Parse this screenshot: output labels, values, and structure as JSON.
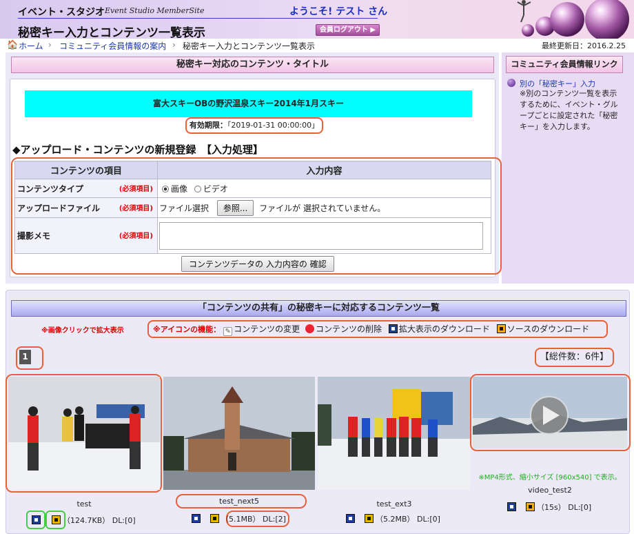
{
  "header": {
    "site_name": "イベント・スタジオ",
    "site_name_en": "Event Studio MemberSite",
    "welcome": "ようこそ! テスト さん",
    "page_title": "秘密キー入力とコンテンツ一覧表示",
    "logout_label": "会員ログアウト"
  },
  "breadcrumb": {
    "home": "ホーム",
    "community": "コミュニティ会員情報の案内",
    "current": "秘密キー入力とコンテンツ一覧表示",
    "last_updated": "最終更新日：2016.2.25"
  },
  "main": {
    "section_title": "秘密キー対応のコンテンツ・タイトル",
    "event_title": "富大スキーOBの野沢温泉スキー2014年1月スキー",
    "expiry_label": "有効期限：",
    "expiry_value": "「2019-01-31 00:00:00」",
    "upload_heading": "◆アップロード・コンテンツの新規登録　【入力処理】",
    "form": {
      "col_item": "コンテンツの項目",
      "col_input": "入力内容",
      "required": "(必須項目)",
      "type_label": "コンテンツタイプ",
      "type_options": [
        "画像",
        "ビデオ"
      ],
      "type_selected": "画像",
      "file_label": "アップロードファイル",
      "file_choose": "ファイル選択",
      "browse_button": "参照...",
      "file_status": "ファイルが 選択されていません。",
      "memo_label": "撮影メモ",
      "confirm_button": "コンテンツデータの 入力内容の 確認"
    }
  },
  "sidebar": {
    "title": "コミュニティ会員情報リンク",
    "link": "別の「秘密キー」入力",
    "description": "※別のコンテンツ一覧を表示するために、イベント・グループごとに設定された「秘密キー」を入力します。"
  },
  "share": {
    "title": "「コンテンツの共有」の秘密キーに対応するコンテンツ一覧",
    "click_note": "※画像クリックで拡大表示",
    "legend_label": "※アイコンの機能：",
    "legend_items": [
      "コンテンツの変更",
      "コンテンツの削除",
      "拡大表示のダウンロード",
      "ソースのダウンロード"
    ],
    "page_number": "1",
    "total": "【総件数：6件】",
    "items": [
      {
        "title": "test",
        "size": "（124.7KB）",
        "dl": "DL:[0]"
      },
      {
        "title": "test_next5",
        "size": "（5.1MB）",
        "dl": "DL:[2]"
      },
      {
        "title": "test_ext3",
        "size": "（5.2MB）",
        "dl": "DL:[0]"
      },
      {
        "title": "video_test2",
        "size": "（15s）",
        "dl": "DL:[0]",
        "note": "※MP4形式、縮小サイズ [960x540] で表示。"
      }
    ]
  },
  "colors": {
    "accent_orange": "#e8603a",
    "cyan": "#00ffff",
    "link_blue": "#1a37b5"
  }
}
